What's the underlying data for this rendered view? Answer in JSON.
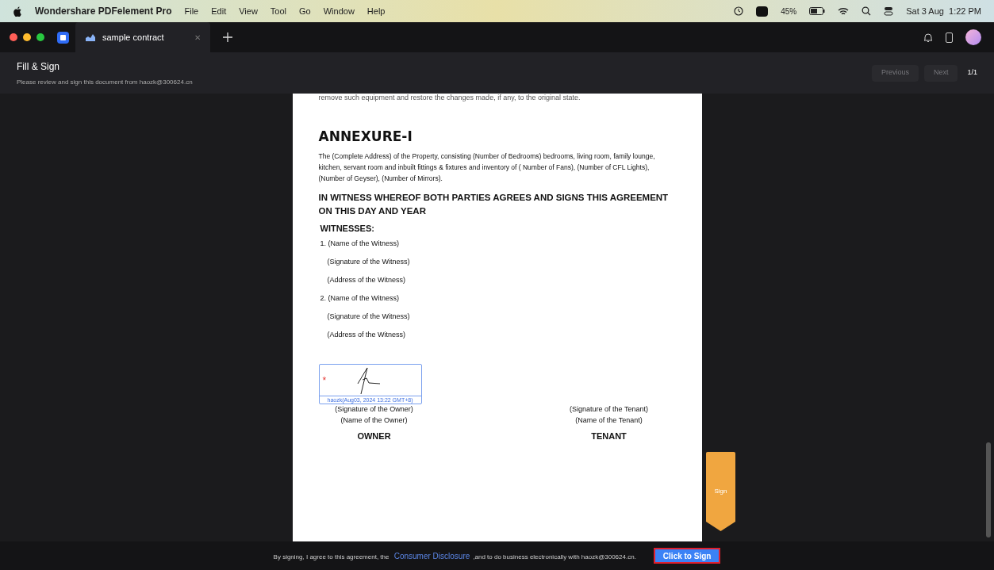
{
  "menu_bar": {
    "app_name": "Wondershare PDFelement Pro",
    "menus": [
      "File",
      "Edit",
      "View",
      "Tool",
      "Go",
      "Window",
      "Help"
    ],
    "battery": "45%",
    "clock": "Sat 3 Aug  1:22 PM"
  },
  "tabs": [
    {
      "label": "sample contract",
      "selected": true,
      "close": "✕"
    }
  ],
  "header": {
    "title": "Fill & Sign",
    "subtitle": "Please review and sign this document from haozk@300624.cn",
    "buttons": [
      {
        "label": "Previous",
        "disabled": true
      },
      {
        "label": "Next",
        "disabled": true
      }
    ],
    "page_count": "1/1"
  },
  "document": {
    "cut_line": "remove such equipment and restore the changes made, if any, to the original state.",
    "heading": "ANNEXURE-I",
    "paragraph": "The (Complete Address) of the Property, consisting (Number of Bedrooms) bedrooms, living room, family lounge, kitchen, servant room and inbuilt fittings & fixtures and inventory of ( Number of Fans), (Number of CFL Lights), (Number of Geyser), (Number of Mirrors).",
    "witness_heading": "IN WITNESS WHEREOF BOTH PARTIES AGREES AND SIGNS THIS AGREEMENT ON THIS DAY AND YEAR",
    "witnesses_label": "WITNESSES:",
    "witness_lines": [
      "1. (Name of the Witness)",
      "(Signature of the Witness)",
      "(Address of the Witness)",
      "2. (Name of the Witness)",
      "(Signature of the Witness)",
      "(Address of the Witness)"
    ],
    "signature_field": {
      "required_mark": "*",
      "stamp": "haozk(Aug03, 2024 13:22 GMT+8)",
      "signed": true
    },
    "parties": [
      {
        "signature_line": "(Signature of the Owner)",
        "name_line": "(Name of the Owner)",
        "role": "OWNER"
      },
      {
        "signature_line": "(Signature of the Tenant)",
        "name_line": "(Name of the Tenant)",
        "role": "TENANT"
      }
    ]
  },
  "sign_tag": "Sign",
  "footer": {
    "text_before": "By signing, I agree to this agreement, the",
    "link": "Consumer Disclosure",
    "text_after": ",and to do business electronically with haozk@300624.cn.",
    "button": "Click to Sign"
  }
}
